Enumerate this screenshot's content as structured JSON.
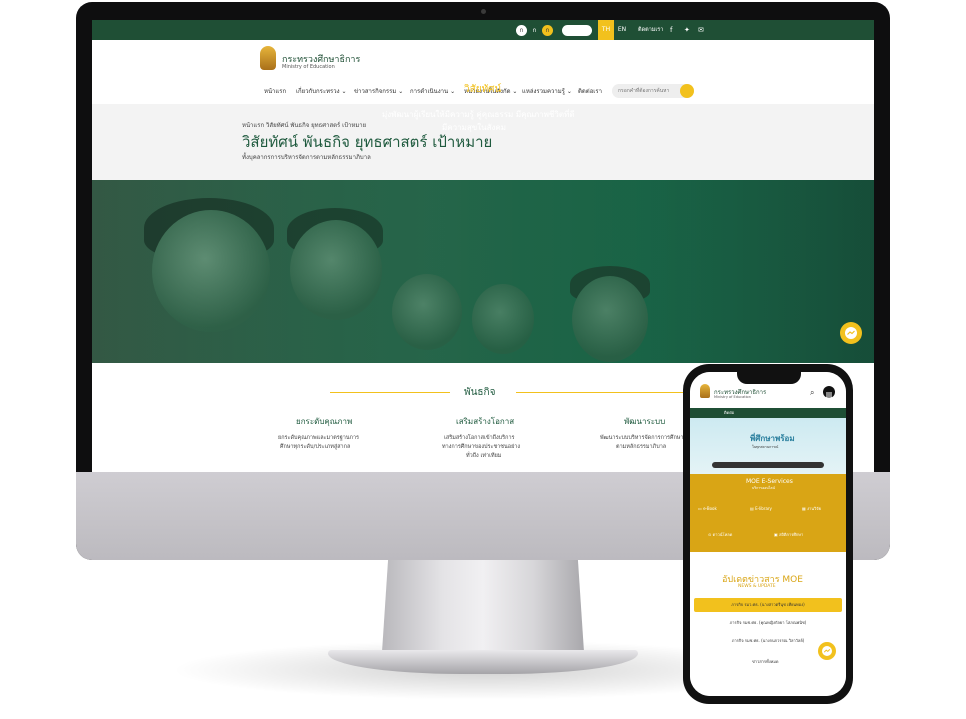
{
  "topbar": {
    "accessibility": [
      "ก",
      "ก",
      "ก"
    ],
    "languages": [
      "TH",
      "EN"
    ],
    "follow_label": "ติดตามเรา",
    "social_icons": [
      "facebook-icon",
      "twitter-icon",
      "mail-icon"
    ],
    "bg_color": "#1f4f35",
    "accent_color": "#f2c11d"
  },
  "header": {
    "logo_title": "กระทรวงศึกษาธิการ",
    "logo_subtitle": "Ministry of Education"
  },
  "nav": {
    "items": [
      "หน้าแรก",
      "เกี่ยวกับกระทรวง",
      "ข่าวสารกิจกรรม",
      "การดำเนินงาน",
      "หน่วยงานในสังกัด",
      "แหล่งรวมความรู้",
      "ติดต่อเรา"
    ],
    "search_placeholder": "กรอกคำที่ต้องการค้นหา"
  },
  "page": {
    "breadcrumb": "หน้าแรก      วิสัยทัศน์ พันธกิจ ยุทธศาสตร์ เป้าหมาย",
    "title": "วิสัยทัศน์ พันธกิจ ยุทธศาสตร์ เป้าหมาย",
    "subtitle": "ทั้งบุคลากรการบริหารจัดการตามหลักธรรมาภิบาล"
  },
  "hero": {
    "vision_title": "วิสัยทัศน์",
    "vision_line1": "มุ่งพัฒนาผู้เรียนให้มีความรู้ คู่คุณธรรม มีคุณภาพชีวิตที่ดี",
    "vision_line2": "มีความสุขในสังคม"
  },
  "mission": {
    "title": "พันธกิจ",
    "columns": [
      {
        "title": "ยกระดับคุณภาพ",
        "line1": "ยกระดับคุณภาพและมาตรฐานการ",
        "line2": "ศึกษาทุกระดับ/ประเภทสู่สากล"
      },
      {
        "title": "เสริมสร้างโอกาส",
        "line1": "เสริมสร้างโอกาสเข้าถึงบริการ",
        "line2": "ทางการศึกษาของประชาชนอย่าง",
        "line3": "ทั่วถึง เท่าเทียม"
      },
      {
        "title": "พัฒนาระบบ",
        "line1": "พัฒนาระบบบริหารจัดการการศึกษา",
        "line2": "ตามหลักธรรมาภิบาล"
      }
    ]
  },
  "phone": {
    "logo_title": "กระทรวงศึกษาธิการ",
    "logo_subtitle": "Ministry of Education",
    "bar_label": "ติดต่อ",
    "banner_title": "พี่ศึกษาพร้อม",
    "banner_sub": "ในทุกสถานการณ์",
    "eservices_title": "MOE E-Services",
    "eservices_sub": "บริการออนไลน์",
    "tiles": [
      "e-Book",
      "E-library",
      "งานวิจัย",
      "ดาวน์โหลด",
      "สถิติการศึกษา"
    ],
    "news_title": "อัปเดตข่าวสาร MOE",
    "news_subtitle": "NEWS & UPDATE",
    "news_items": [
      "ภารกิจ รมว.ศธ. (นางสาวตรีนุช เทียนทอง)",
      "ภารกิจ รมช.ศธ. (คุณหญิงกัลยา โสภณพนิช)",
      "ภารกิจ รมช.ศธ. (นางกนกวรรณ วิลาวัลย์)"
    ],
    "all_label": "ข่าวสารทั้งหมด"
  }
}
